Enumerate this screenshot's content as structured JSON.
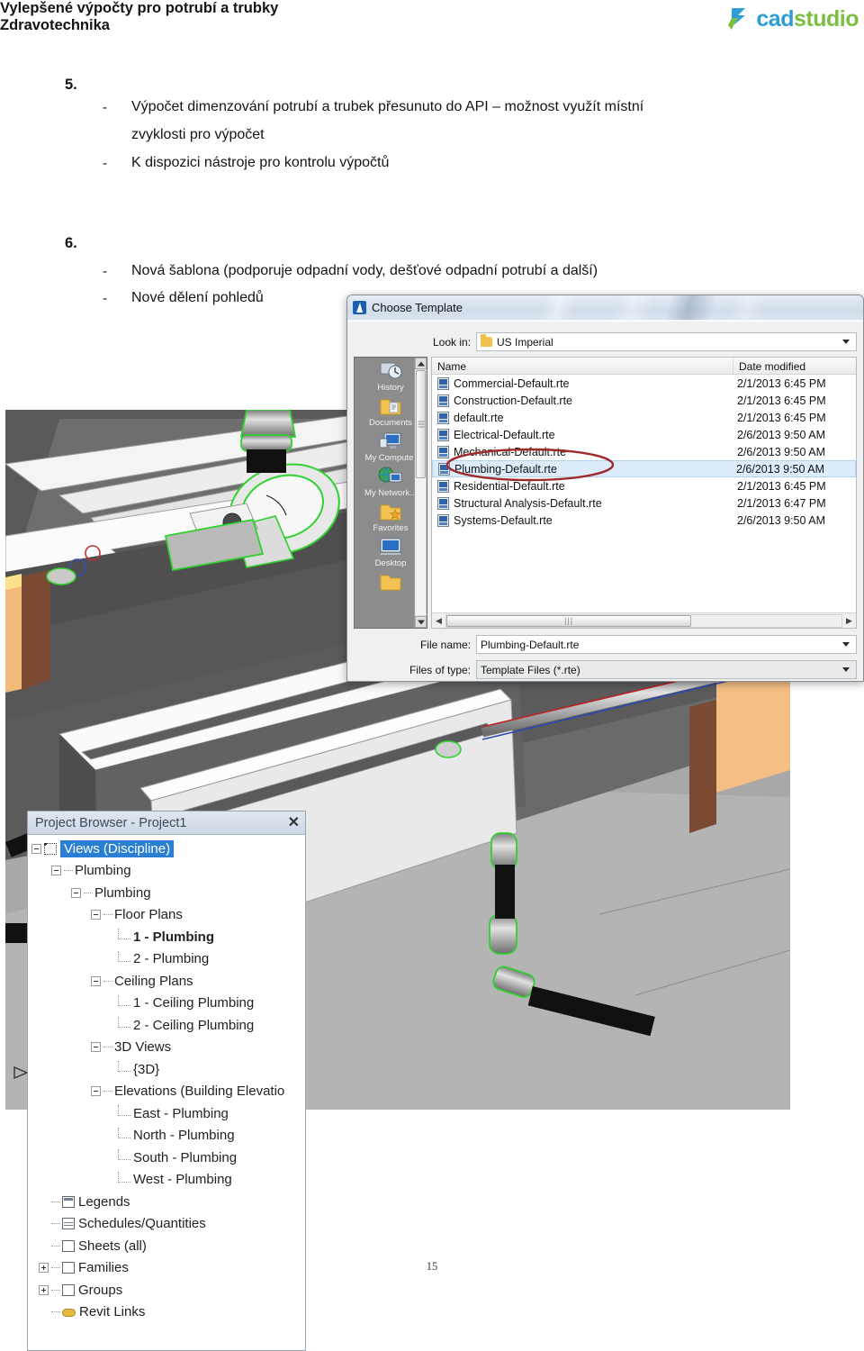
{
  "brand": {
    "name_part1": "cad",
    "name_part2": "studio",
    "color_blue": "#2e9fd4",
    "color_green": "#7cbf43"
  },
  "document": {
    "sections": [
      {
        "number": "5.",
        "heading": "Vylepšené výpočty pro potrubí a trubky",
        "bullets": [
          "Výpočet dimenzování potrubí a trubek přesunuto do API – možnost využít místní",
          "zvyklosti pro výpočet",
          "K dispozici nástroje pro kontrolu výpočtů"
        ]
      },
      {
        "number": "6.",
        "heading": "Zdravotechnika",
        "bullets": [
          "Nová šablona (podporuje odpadní vody, dešťové odpadní potrubí a další)",
          "Nové dělení pohledů"
        ]
      }
    ],
    "page_number": "15"
  },
  "dialog": {
    "title": "Choose Template",
    "icon": "revit-icon",
    "look_in_label": "Look in:",
    "look_in_value": "US Imperial",
    "columns": {
      "name": "Name",
      "date_modified": "Date modified"
    },
    "files": [
      {
        "name": "Commercial-Default.rte",
        "date": "2/1/2013 6:45 PM",
        "selected": false
      },
      {
        "name": "Construction-Default.rte",
        "date": "2/1/2013 6:45 PM",
        "selected": false
      },
      {
        "name": "default.rte",
        "date": "2/1/2013 6:45 PM",
        "selected": false
      },
      {
        "name": "Electrical-Default.rte",
        "date": "2/6/2013 9:50 AM",
        "selected": false
      },
      {
        "name": "Mechanical-Default.rte",
        "date": "2/6/2013 9:50 AM",
        "selected": false
      },
      {
        "name": "Plumbing-Default.rte",
        "date": "2/6/2013 9:50 AM",
        "selected": true
      },
      {
        "name": "Residential-Default.rte",
        "date": "2/1/2013 6:45 PM",
        "selected": false
      },
      {
        "name": "Structural Analysis-Default.rte",
        "date": "2/1/2013 6:47 PM",
        "selected": false
      },
      {
        "name": "Systems-Default.rte",
        "date": "2/6/2013 9:50 AM",
        "selected": false
      }
    ],
    "places": [
      {
        "label": "History",
        "icon": "history-icon"
      },
      {
        "label": "Documents",
        "icon": "documents-folder-icon"
      },
      {
        "label": "My Computer",
        "icon": "my-computer-icon"
      },
      {
        "label": "My Network...",
        "icon": "my-network-icon"
      },
      {
        "label": "Favorites",
        "icon": "favorites-folder-icon"
      },
      {
        "label": "Desktop",
        "icon": "desktop-icon"
      }
    ],
    "file_name_label": "File name:",
    "file_name_value": "Plumbing-Default.rte",
    "files_of_type_label": "Files of type:",
    "files_of_type_value": "Template Files  (*.rte)",
    "annotation": {
      "shape": "red-ellipse",
      "color": "#9c2b2b",
      "targets": "Plumbing-Default.rte"
    }
  },
  "project_browser": {
    "title": "Project Browser - Project1",
    "close_label": "✕",
    "tree": [
      {
        "label": "Views (Discipline)",
        "depth": 0,
        "state": "minus",
        "selected": true,
        "bold": false,
        "icon": "crop-view-icon"
      },
      {
        "label": "Plumbing",
        "depth": 1,
        "state": "minus",
        "selected": false,
        "bold": false,
        "icon": ""
      },
      {
        "label": "Plumbing",
        "depth": 2,
        "state": "minus",
        "selected": false,
        "bold": false,
        "icon": ""
      },
      {
        "label": "Floor Plans",
        "depth": 3,
        "state": "minus",
        "selected": false,
        "bold": false,
        "icon": ""
      },
      {
        "label": "1 - Plumbing",
        "depth": 4,
        "state": "leaf",
        "selected": false,
        "bold": true,
        "icon": ""
      },
      {
        "label": "2 - Plumbing",
        "depth": 4,
        "state": "leaf",
        "selected": false,
        "bold": false,
        "icon": ""
      },
      {
        "label": "Ceiling Plans",
        "depth": 3,
        "state": "minus",
        "selected": false,
        "bold": false,
        "icon": ""
      },
      {
        "label": "1 - Ceiling Plumbing",
        "depth": 4,
        "state": "leaf",
        "selected": false,
        "bold": false,
        "icon": ""
      },
      {
        "label": "2 - Ceiling Plumbing",
        "depth": 4,
        "state": "leaf",
        "selected": false,
        "bold": false,
        "icon": ""
      },
      {
        "label": "3D Views",
        "depth": 3,
        "state": "minus",
        "selected": false,
        "bold": false,
        "icon": ""
      },
      {
        "label": "{3D}",
        "depth": 4,
        "state": "leaf",
        "selected": false,
        "bold": false,
        "icon": ""
      },
      {
        "label": "Elevations (Building Elevatio",
        "depth": 3,
        "state": "minus",
        "selected": false,
        "bold": false,
        "icon": ""
      },
      {
        "label": "East - Plumbing",
        "depth": 4,
        "state": "leaf",
        "selected": false,
        "bold": false,
        "icon": ""
      },
      {
        "label": "North - Plumbing",
        "depth": 4,
        "state": "leaf",
        "selected": false,
        "bold": false,
        "icon": ""
      },
      {
        "label": "South - Plumbing",
        "depth": 4,
        "state": "leaf",
        "selected": false,
        "bold": false,
        "icon": ""
      },
      {
        "label": "West - Plumbing",
        "depth": 4,
        "state": "leaf",
        "selected": false,
        "bold": false,
        "icon": ""
      },
      {
        "label": "Legends",
        "depth": 1,
        "state": "leaf",
        "selected": false,
        "bold": false,
        "icon": "legend-icon"
      },
      {
        "label": "Schedules/Quantities",
        "depth": 1,
        "state": "leaf",
        "selected": false,
        "bold": false,
        "icon": "schedule-icon"
      },
      {
        "label": "Sheets (all)",
        "depth": 1,
        "state": "leaf",
        "selected": false,
        "bold": false,
        "icon": "sheet-icon"
      },
      {
        "label": "Families",
        "depth": 1,
        "state": "plus",
        "selected": false,
        "bold": false,
        "icon": "family-icon"
      },
      {
        "label": "Groups",
        "depth": 1,
        "state": "plus",
        "selected": false,
        "bold": false,
        "icon": "group-icon"
      },
      {
        "label": "Revit Links",
        "depth": 1,
        "state": "leaf",
        "selected": false,
        "bold": false,
        "icon": "link-icon"
      }
    ]
  },
  "viewport_3d": {
    "name": "revit-3d-plumbing-view",
    "annotation_number": "0",
    "annotation_color": "#cc2222",
    "selection_color": "#2fd22f",
    "background": "#5a5a5a"
  }
}
